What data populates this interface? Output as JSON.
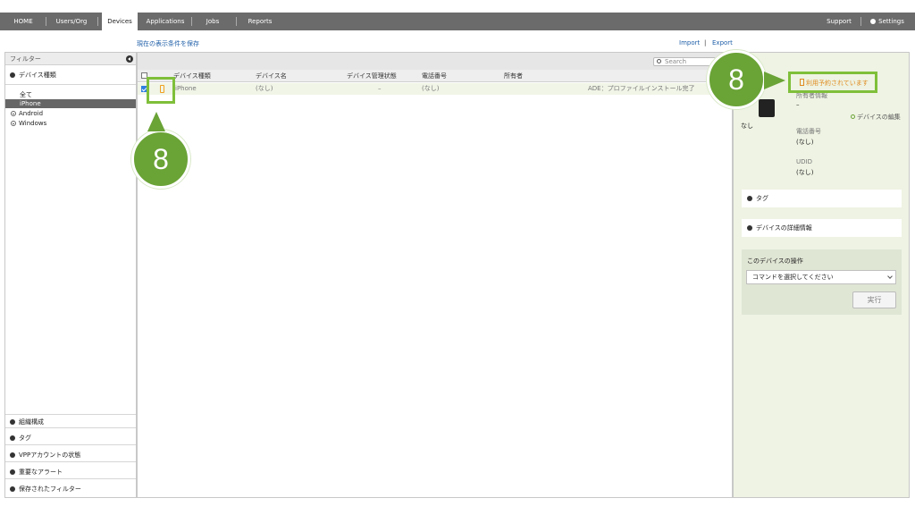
{
  "nav": {
    "home": "HOME",
    "users": "Users/Org",
    "devices": "Devices",
    "applications": "Applications",
    "jobs": "Jobs",
    "reports": "Reports",
    "support": "Support",
    "settings": "Settings"
  },
  "links": {
    "save_filter": "現在の表示条件を保存",
    "import": "Import",
    "divider": "|",
    "export": "Export"
  },
  "sidebar": {
    "filter_header": "フィルター",
    "device_type": "デバイス種類",
    "items": [
      "全て",
      "iPhone",
      "Android",
      "Windows"
    ],
    "bottom_sections": [
      "組織構成",
      "タグ",
      "VPPアカウントの状態",
      "重要なアラート",
      "保存されたフィルター"
    ]
  },
  "table": {
    "search_placeholder": "Search",
    "columns": [
      "デバイス種類",
      "デバイス名",
      "デバイス管理状態",
      "電話番号",
      "所有者"
    ],
    "rows": [
      {
        "type": "iPhone",
        "name": "(なし)",
        "status": "–",
        "phone": "(なし)",
        "owner": "",
        "note": "ADE：プロファイルインストール完了"
      }
    ]
  },
  "detail": {
    "reserved": "利用予約されています",
    "owner_info_label": "所有者情報",
    "owner_info_value": "–",
    "edit_device": "デバイスの編集",
    "name_value": "なし",
    "phone_label": "電話番号",
    "phone_value": "(なし)",
    "udid_label": "UDID",
    "udid_value": "(なし)",
    "tag": "タグ",
    "device_details": "デバイスの詳細情報",
    "ops_title": "このデバイスの操作",
    "cmd_placeholder": "コマンドを選択してください",
    "run": "実行"
  },
  "annotations": {
    "step": "8"
  },
  "colors": {
    "accent_green": "#6aa336",
    "highlight_green": "#7fbf3a",
    "nav_bg": "#6b6b6b",
    "link_blue": "#1f5fa8",
    "warning_orange": "#f0a020"
  }
}
